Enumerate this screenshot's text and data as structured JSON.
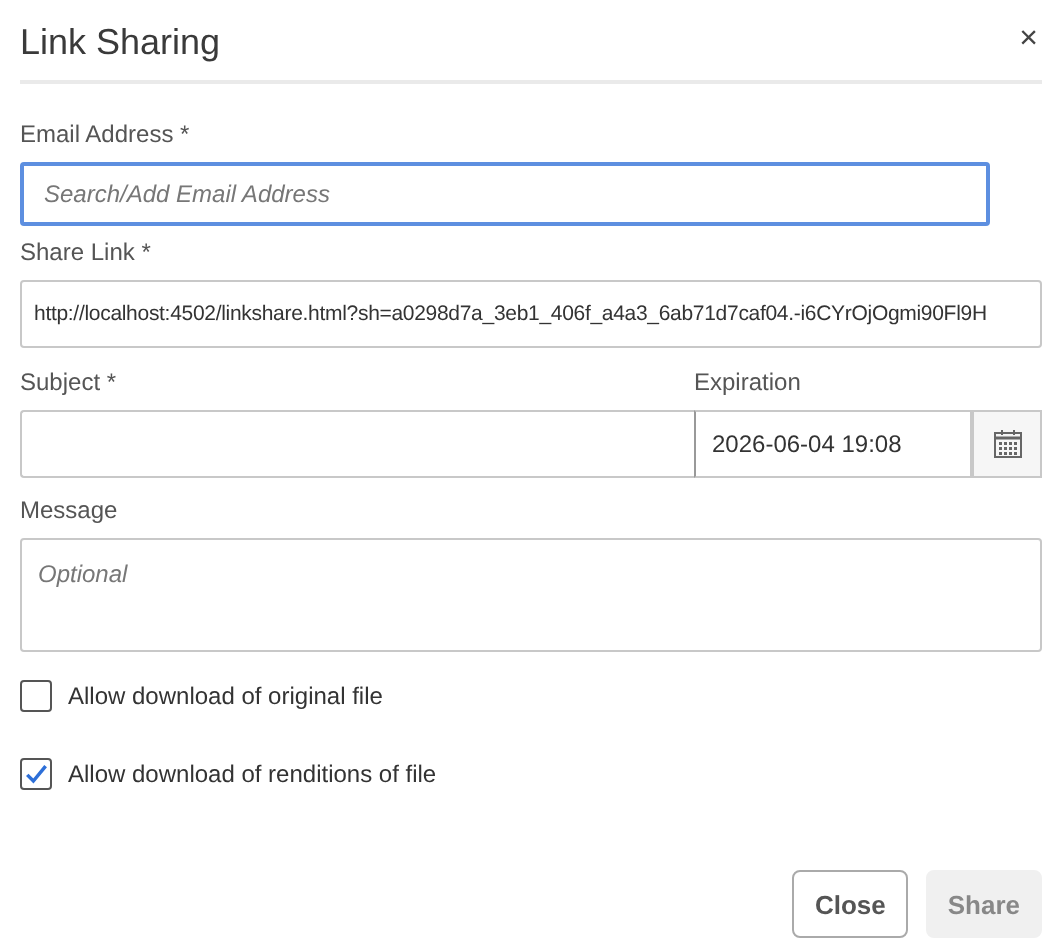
{
  "dialog": {
    "title": "Link Sharing",
    "close_glyph": "×"
  },
  "email": {
    "label": "Email Address *",
    "placeholder": "Search/Add Email Address",
    "focused": true
  },
  "share_link": {
    "label": "Share Link *",
    "value": "http://localhost:4502/linkshare.html?sh=a0298d7a_3eb1_406f_a4a3_6ab71d7caf04.-i6CYrOjOgmi90Fl9H"
  },
  "subject": {
    "label": "Subject *"
  },
  "expiration": {
    "label": "Expiration",
    "value": "2026-06-04 19:08"
  },
  "message": {
    "label": "Message",
    "placeholder": "Optional"
  },
  "options": [
    {
      "label": "Allow download of original file",
      "checked": false
    },
    {
      "label": "Allow download of renditions of file",
      "checked": true
    }
  ],
  "buttons": [
    {
      "label": "Close",
      "disabled": false
    },
    {
      "label": "Share",
      "disabled": true
    }
  ]
}
